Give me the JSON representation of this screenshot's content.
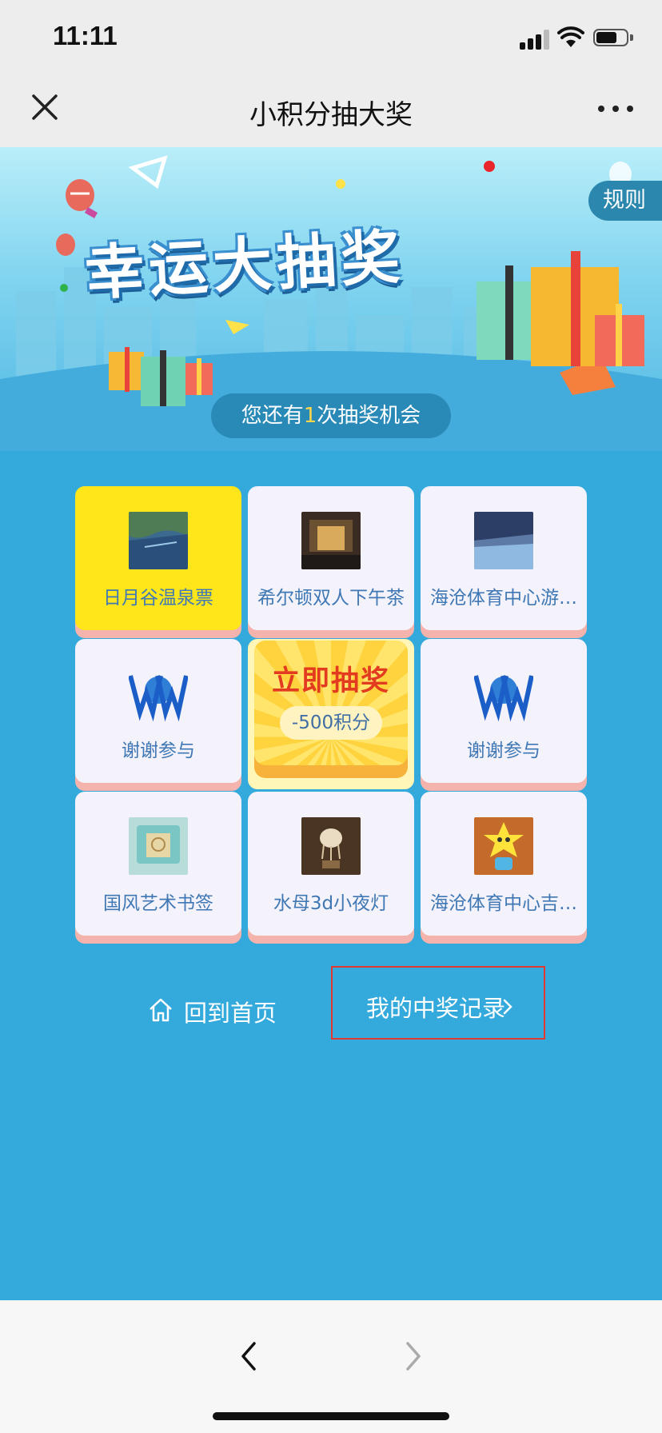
{
  "status_bar": {
    "time": "11:11"
  },
  "nav": {
    "title": "小积分抽大奖"
  },
  "hero": {
    "title": "幸运大抽奖",
    "rules_label": "规则",
    "chance_prefix": "您还有",
    "chance_count": "1",
    "chance_suffix": "次抽奖机会"
  },
  "prizes": [
    {
      "label": "日月谷温泉票",
      "image": "hot-spring-photo",
      "selected": true
    },
    {
      "label": "希尔顿双人下午茶",
      "image": "hilton-lobby-photo",
      "selected": false
    },
    {
      "label": "海沧体育中心游…",
      "image": "swimming-pool-photo",
      "selected": false
    },
    {
      "label": "谢谢参与",
      "image": "wow-logo",
      "selected": false
    },
    {
      "label": "谢谢参与",
      "image": "wow-logo",
      "selected": false
    },
    {
      "label": "国风艺术书签",
      "image": "bookmark-photo",
      "selected": false
    },
    {
      "label": "水母3d小夜灯",
      "image": "jellyfish-lamp-photo",
      "selected": false
    },
    {
      "label": "海沧体育中心吉…",
      "image": "mascot-photo",
      "selected": false
    }
  ],
  "draw_button": {
    "title": "立即抽奖",
    "cost": "-500积分"
  },
  "links": {
    "home": "回到首页",
    "records": "我的中奖记录"
  },
  "colors": {
    "background": "#34a9db",
    "selected_cell": "#ffe61a",
    "cell": "#f4f2fb",
    "cell_label": "#3f78b4",
    "draw_title": "#e23b1f",
    "highlight_box": "#e03a30"
  }
}
